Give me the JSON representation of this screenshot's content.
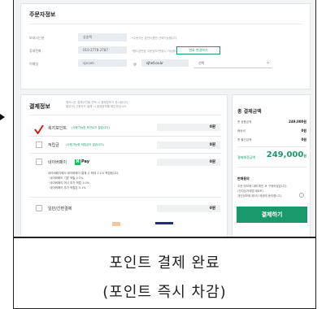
{
  "orderer": {
    "title": "주문자정보",
    "name_label": "보내시는분",
    "name_value": "상송택",
    "name_note": "*주문자는 본인이름만 선택가능합니다.",
    "phone_label": "휴대전화",
    "phone_value": "010-2778-3787",
    "phone_note": "*핸드폰번호 주문정보 변경시 가능합니다.",
    "change_phone_label": "번호 변경하기",
    "email_label": "이메일",
    "email_id": "sjscom",
    "email_at": "@",
    "email_domain": "sjhrd.co.kr",
    "email_select": "선택"
  },
  "payment": {
    "title": "결제정보",
    "note1": "원하시는 결제수단을 선택 시 결제정보가 표시됩니다.",
    "note2": "할부/여 신용카드 결제 시 결제정보를 확인하십시오.",
    "welfare_label": "복지포인트",
    "welfare_note": "(사용가능한 포인트가 없습니다)",
    "welfare_value": "0원",
    "reserve_label": "적립금",
    "reserve_note": "(사용가능한 적립금이 없습니다)",
    "reserve_value": "0원",
    "naverpay_label": "네이버페이",
    "naverpay_badge": "N",
    "naverpay_pay": "Pay",
    "naverpay_value": "0원",
    "naverpay_notes": [
      "네이버페이에서 네이버페이 결제 시 최대 1.1% 적립됩니다.",
      "· 네이버페이 기본 적립 0.1%",
      "· 네이버페이 머니 추가 적립 1.0%",
      "· 네이버페이 추가 적립은 0.1%"
    ],
    "simple_label": "일반/간편결제",
    "simple_value": "0원"
  },
  "summary": {
    "title": "총 결제금액",
    "rows": [
      {
        "label": "총 상품금액",
        "value": "249,000원"
      },
      {
        "label": "배송비",
        "value": "0원"
      },
      {
        "label": "총 할인금액",
        "value": "0원"
      }
    ],
    "final_label": "결제예정금액",
    "final_value": "249,000",
    "final_unit": "원",
    "agree_title": "판매동의",
    "agree_lines": [
      "주문 정보에 대해 확인 후 구매하겠습니다.",
      "(전자상거래법 제8조)",
      "개인정보제 제3자 제공에 동의합니다."
    ],
    "pay_button": "결제하기"
  },
  "caption": {
    "line1": "포인트 결제 완료",
    "line2": "(포인트 즉시 차감)"
  },
  "colors": {
    "accent": "#1a9a6c",
    "check": "#cc1f1f",
    "naver": "#03c75a"
  }
}
